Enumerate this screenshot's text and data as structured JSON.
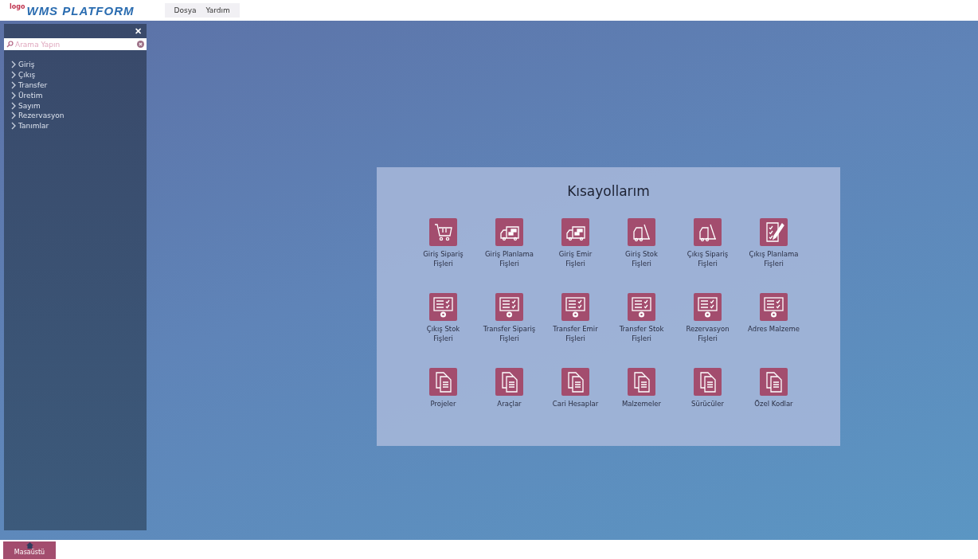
{
  "header": {
    "logo_prefix": "logo",
    "logo": "WMS PLATFORM",
    "menu": [
      "Dosya",
      "Yardım"
    ]
  },
  "sidebar": {
    "close": "✕",
    "search": {
      "placeholder": "Arama Yapın"
    },
    "items": [
      {
        "label": "Giriş",
        "expanded": false
      },
      {
        "label": "Çıkış",
        "expanded": false
      },
      {
        "label": "Transfer",
        "expanded": false
      },
      {
        "label": "Üretim",
        "expanded": false
      },
      {
        "label": "Sayım",
        "expanded": false
      },
      {
        "label": "Rezervasyon",
        "expanded": false
      },
      {
        "label": "Tanımlar",
        "expanded": false
      }
    ]
  },
  "shortcuts": {
    "title": "Kısayollarım",
    "items": [
      {
        "label": "Giriş Sipariş Fişleri",
        "kind": "cart"
      },
      {
        "label": "Giriş Planlama Fişleri",
        "kind": "truck"
      },
      {
        "label": "Giriş Emir Fişleri",
        "kind": "truck"
      },
      {
        "label": "Giriş Stok Fişleri",
        "kind": "forklift"
      },
      {
        "label": "Çıkış Sipariş Fişleri",
        "kind": "forklift"
      },
      {
        "label": "Çıkış Planlama Fişleri",
        "kind": "checklist"
      },
      {
        "label": "Çıkış Stok Fişleri",
        "kind": "report"
      },
      {
        "label": "Transfer Sipariş Fişleri",
        "kind": "report"
      },
      {
        "label": "Transfer Emir Fişleri",
        "kind": "report"
      },
      {
        "label": "Transfer Stok Fişleri",
        "kind": "report"
      },
      {
        "label": "Rezervasyon Fişleri",
        "kind": "report"
      },
      {
        "label": "Adres Malzeme",
        "kind": "report"
      },
      {
        "label": "Projeler",
        "kind": "document"
      },
      {
        "label": "Araçlar",
        "kind": "document"
      },
      {
        "label": "Cari Hesaplar",
        "kind": "document"
      },
      {
        "label": "Malzemeler",
        "kind": "document"
      },
      {
        "label": "Sürücüler",
        "kind": "document"
      },
      {
        "label": "Özel Kodlar",
        "kind": "document"
      }
    ]
  },
  "taskbar": {
    "items": [
      {
        "label": "Masaüstü",
        "selected": true
      }
    ]
  }
}
